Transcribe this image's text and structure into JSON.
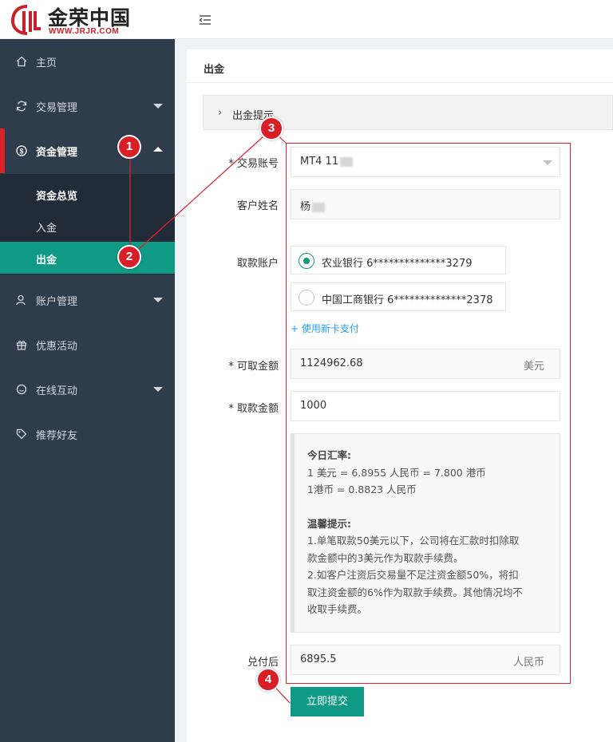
{
  "brand": {
    "title": "金荣中国",
    "subtitle": "WWW.JRJR.COM",
    "color": "#c9212a"
  },
  "sidebar": {
    "items": [
      {
        "label": "主页",
        "icon": "home-icon"
      },
      {
        "label": "交易管理",
        "icon": "refresh-icon"
      },
      {
        "label": "资金管理",
        "icon": "dollar-icon"
      },
      {
        "label": "账户管理",
        "icon": "user-icon"
      },
      {
        "label": "优惠活动",
        "icon": "gift-icon"
      },
      {
        "label": "在线互动",
        "icon": "chat-icon"
      },
      {
        "label": "推荐好友",
        "icon": "tag-icon"
      }
    ],
    "submenu": [
      {
        "label": "资金总览"
      },
      {
        "label": "入金"
      },
      {
        "label": "出金"
      }
    ],
    "accent": "#0e9a85",
    "active_marker": "#d8232a"
  },
  "page": {
    "title": "出金",
    "notice_label": "出金提示"
  },
  "form": {
    "account_label": "* 交易账号",
    "account_value": "MT4 11",
    "name_label": "客户姓名",
    "name_value": "杨",
    "withdraw_account_label": "取款账户",
    "bank_options": [
      {
        "label": "农业银行 6**************3279",
        "selected": true
      },
      {
        "label": "中国工商银行 6**************2378",
        "selected": false
      }
    ],
    "new_card_link": "+ 使用新卡支付",
    "available_label": "* 可取金额",
    "available_value": "1124962.68",
    "available_unit": "美元",
    "amount_label": "* 取款金额",
    "amount_value": "1000",
    "info": {
      "rate_heading": "今日汇率:",
      "rate_line1": "1 美元 = 6.8955 人民币 = 7.800 港币",
      "rate_line2": "1港币 = 0.8823 人民币",
      "tip_heading": "温馨提示:",
      "tip_line1": "1.单笔取款50美元以下，公司将在汇款时扣除取",
      "tip_line2": "款金额中的3美元作为取款手续费。",
      "tip_line3": "2.如客户注资后交易量不足注资金额50%，将扣",
      "tip_line4": "取注资金额的6%作为取款手续费。其他情况均不",
      "tip_line5": "收取手续费。"
    },
    "converted_label": "兑付后",
    "converted_value": "6895.5",
    "converted_unit": "人民币",
    "submit_label": "立即提交"
  },
  "annotations": {
    "badges": [
      "1",
      "2",
      "3",
      "4"
    ],
    "color": "#e2222a"
  }
}
